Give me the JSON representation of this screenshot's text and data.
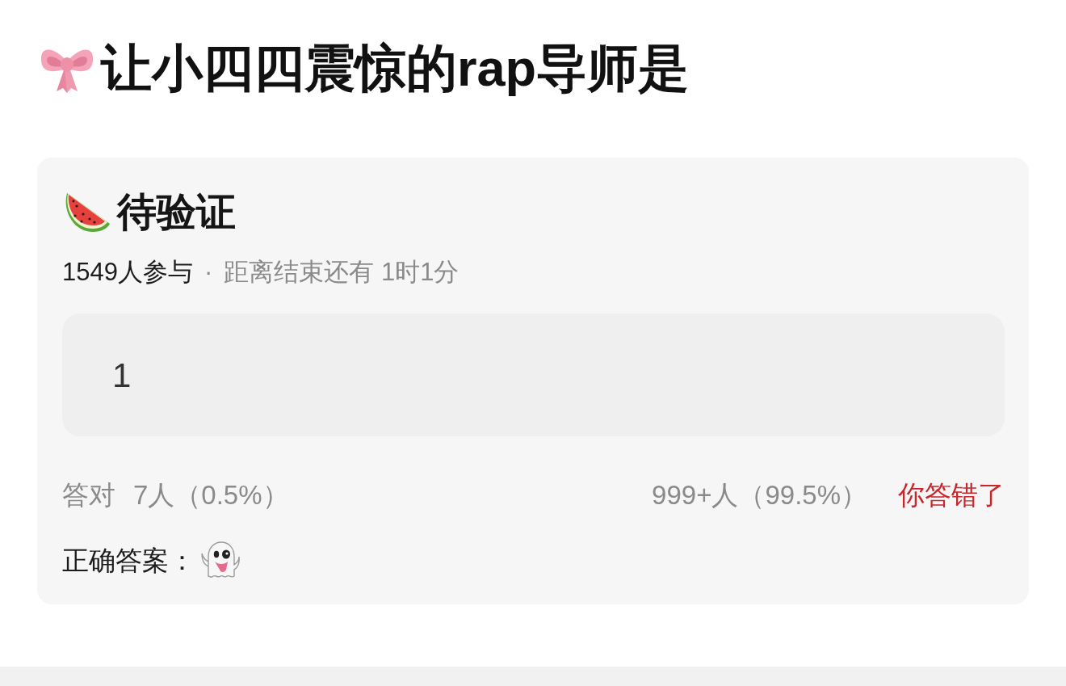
{
  "question": {
    "title": "让小四四震惊的rap导师是"
  },
  "quiz": {
    "status": "待验证",
    "participants": "1549人参与",
    "separator": "·",
    "countdown": "距离结束还有 1时1分",
    "answer": {
      "value": "1"
    },
    "stats": {
      "correct_label": "答对",
      "correct_count": "7人（0.5%）",
      "wrong_count": "999+人（99.5%）"
    },
    "result": {
      "text": "你答错了",
      "correct": false
    },
    "correct_answer": {
      "label": "正确答案："
    }
  }
}
